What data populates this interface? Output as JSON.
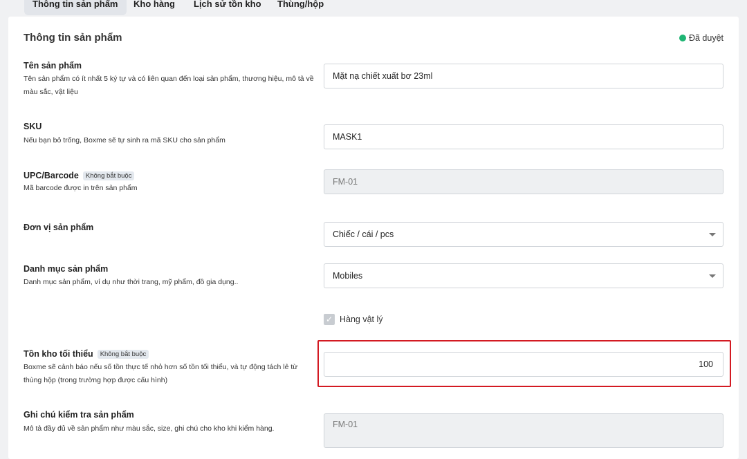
{
  "tabs": [
    {
      "label": "Thông tin sản phẩm",
      "active": true
    },
    {
      "label": "Kho hàng"
    },
    {
      "label": "Lịch sử tồn kho"
    },
    {
      "label": "Thùng/hộp"
    }
  ],
  "section": {
    "title": "Thông tin sản phẩm",
    "status": "Đã duyệt",
    "status_color": "#1fb574"
  },
  "fields": {
    "name": {
      "label": "Tên sản phẩm",
      "desc": "Tên sản phẩm có ít nhất 5 ký tự và có liên quan đến loại sản phẩm, thương hiệu, mô tả về màu sắc, vật liệu",
      "value": "Mặt nạ chiết xuất bơ 23ml"
    },
    "sku": {
      "label": "SKU",
      "desc": "Nếu bạn bỏ trống, Boxme sẽ tự sinh ra mã SKU cho sản phẩm",
      "value": "MASK1"
    },
    "upc": {
      "label": "UPC/Barcode",
      "badge": "Không bắt buộc",
      "desc": "Mã barcode được in trên sản phẩm",
      "value": "FM-01"
    },
    "unit": {
      "label": "Đơn vị sản phẩm",
      "value": "Chiếc / cái / pcs"
    },
    "category": {
      "label": "Danh mục sản phẩm",
      "desc": "Danh mục sản phẩm, ví dụ như thời trang, mỹ phẩm, đồ gia dụng..",
      "value": "Mobiles"
    },
    "physical": {
      "label": "Hàng vật lý",
      "checked": true
    },
    "min_stock": {
      "label": "Tồn kho tối thiểu",
      "badge": "Không bắt buộc",
      "desc": "Boxme sẽ cảnh báo nếu số tồn thực tế nhỏ hơn số tồn tối thiểu, và tự động tách lẻ từ thùng hộp (trong trường hợp được cấu hình)",
      "value": "100"
    },
    "note": {
      "label": "Ghi chú kiểm tra sản phẩm",
      "desc": "Mô tả đầy đủ về sản phẩm như màu sắc, size, ghi chú cho kho khi kiểm hàng.",
      "value": "FM-01"
    }
  },
  "highlight_color": "#d31a22"
}
